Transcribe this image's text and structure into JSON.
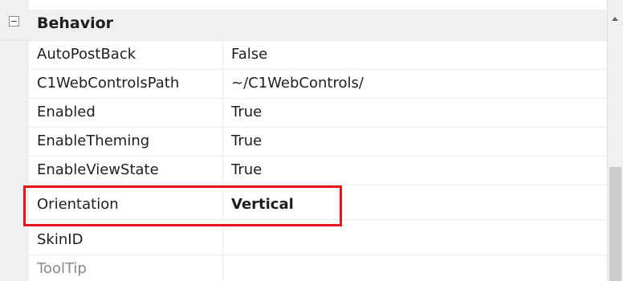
{
  "category": {
    "label": "Behavior",
    "expander_glyph": "minus"
  },
  "properties": [
    {
      "name": "AutoPostBack",
      "value": "False",
      "bold": false
    },
    {
      "name": "C1WebControlsPath",
      "value": "~/C1WebControls/",
      "bold": false
    },
    {
      "name": "Enabled",
      "value": "True",
      "bold": false
    },
    {
      "name": "EnableTheming",
      "value": "True",
      "bold": false
    },
    {
      "name": "EnableViewState",
      "value": "True",
      "bold": false
    },
    {
      "name": "Orientation",
      "value": "Vertical",
      "bold": true
    },
    {
      "name": "SkinID",
      "value": "",
      "bold": false
    },
    {
      "name": "ToolTip",
      "value": "",
      "bold": false
    }
  ],
  "highlight": {
    "color": "#e8141b",
    "target": "Orientation"
  },
  "icons": {
    "expander": "collapse-minus-icon",
    "scroll_up": "scroll-up-arrow-icon"
  }
}
